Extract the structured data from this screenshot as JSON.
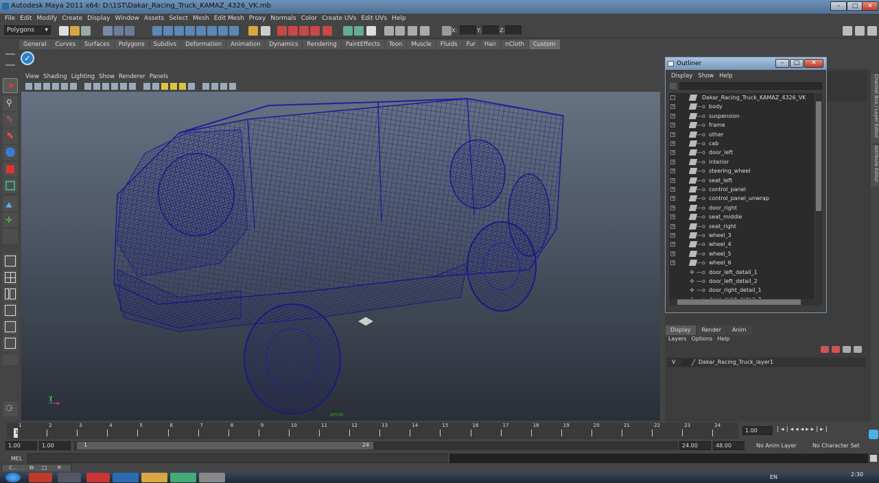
{
  "window": {
    "title": "Autodesk Maya 2011 x64: D:\\1ST\\Dakar_Racing_Truck_KAMAZ_4326_VK.mb"
  },
  "menu": [
    "File",
    "Edit",
    "Modify",
    "Create",
    "Display",
    "Window",
    "Assets",
    "Select",
    "Mesh",
    "Edit Mesh",
    "Proxy",
    "Normals",
    "Color",
    "Create UVs",
    "Edit UVs",
    "Help"
  ],
  "status_line": {
    "menu_set": "Polygons",
    "x_label": "X:",
    "y_label": "Y:",
    "z_label": "Z:"
  },
  "shelf_tabs": [
    "General",
    "Curves",
    "Surfaces",
    "Polygons",
    "Subdivs",
    "Deformation",
    "Animation",
    "Dynamics",
    "Rendering",
    "PaintEffects",
    "Toon",
    "Muscle",
    "Fluids",
    "Fur",
    "Hair",
    "nCloth",
    "Custom"
  ],
  "shelf_active": "Custom",
  "viewport": {
    "menu": [
      "View",
      "Shading",
      "Lighting",
      "Show",
      "Renderer",
      "Panels"
    ],
    "camera_label": "persp",
    "axis_y": "y",
    "axis_x": "x"
  },
  "outliner": {
    "title": "Outliner",
    "menu": [
      "Display",
      "Show",
      "Help"
    ],
    "root": "Dakar_Racing_Truck_KAMAZ_4326_VK",
    "items": [
      "body",
      "suspension",
      "frame",
      "other",
      "cab",
      "door_left",
      "interior",
      "steering_wheel",
      "seat_left",
      "control_panel",
      "control_panel_unwrap",
      "door_right",
      "seat_middle",
      "seat_right",
      "wheel_3",
      "wheel_4",
      "wheel_5",
      "wheel_6"
    ],
    "detail_items": [
      "door_left_detail_1",
      "door_left_detail_2",
      "door_right_detail_1",
      "door_right_detail_2"
    ]
  },
  "side_tabs": [
    "Channel Box / Layer Editor",
    "Attribute Editor"
  ],
  "layer_editor": {
    "tabs": [
      "Display",
      "Render",
      "Anim"
    ],
    "active_tab": "Display",
    "menu": [
      "Layers",
      "Options",
      "Help"
    ],
    "layer_visibility": "V",
    "layer_name": "Dakar_Racing_Truck_layer1"
  },
  "time_slider": {
    "ticks": [
      "1",
      "2",
      "3",
      "4",
      "5",
      "6",
      "7",
      "8",
      "9",
      "10",
      "11",
      "12",
      "13",
      "14",
      "15",
      "16",
      "17",
      "18",
      "19",
      "20",
      "21",
      "22",
      "23",
      "24"
    ],
    "current_frame": "1.00",
    "current_label": "1"
  },
  "range_slider": {
    "start": "1.00",
    "playback_start": "1.00",
    "range_start_label": "1",
    "range_end_label": "24",
    "playback_end": "24.00",
    "end": "48.00",
    "anim_layer": "No Anim Layer",
    "char_set": "No Character Set"
  },
  "command_line": {
    "label": "MEL"
  },
  "minimized_window": {
    "label": "C..."
  },
  "taskbar": {
    "time": "2:30",
    "lang": "EN"
  }
}
